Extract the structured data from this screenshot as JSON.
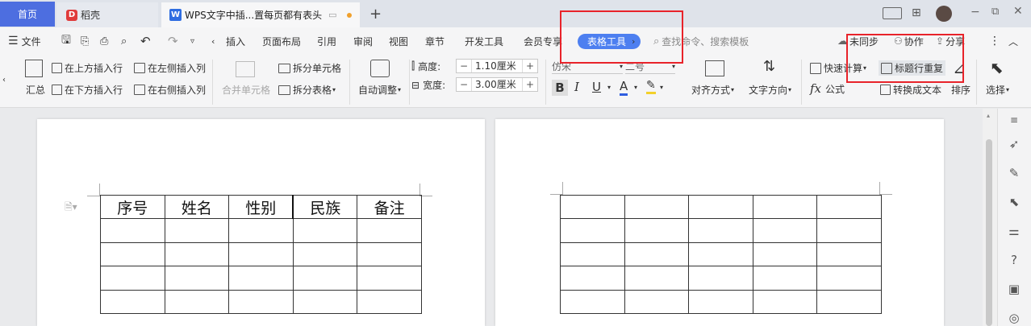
{
  "tabs": {
    "home": "首页",
    "daoke": "稻壳",
    "doc_title": "WPS文字中插...置每页都有表头"
  },
  "menu": {
    "file": "文件",
    "items": [
      "插入",
      "页面布局",
      "引用",
      "审阅",
      "视图",
      "章节",
      "开发工具",
      "会员专享"
    ],
    "table_tools": "表格工具",
    "search_placeholder": "查找命令、搜索模板",
    "unsynced": "未同步",
    "collab": "协作",
    "share": "分享"
  },
  "ribbon": {
    "summary": "汇总",
    "insert_above": "在上方插入行",
    "insert_left": "在左侧插入列",
    "insert_below": "在下方插入行",
    "insert_right": "在右侧插入列",
    "merge_cells": "合并单元格",
    "split_cell": "拆分单元格",
    "split_table": "拆分表格",
    "autofit": "自动调整",
    "height_label": "高度:",
    "height_value": "1.10厘米",
    "width_label": "宽度:",
    "width_value": "3.00厘米",
    "font_name": "仿宋",
    "font_size": "二号",
    "align": "对齐方式",
    "text_dir": "文字方向",
    "quick_calc": "快速计算",
    "formula": "公式",
    "title_repeat": "标题行重复",
    "convert_text": "转换成文本",
    "sort": "排序",
    "select": "选择",
    "step_minus": "−",
    "step_plus": "+"
  },
  "table": {
    "headers": [
      "序号",
      "姓名",
      "性别",
      "民族",
      "备注"
    ]
  },
  "colors": {
    "accent": "#4d7ff0",
    "highlight_box": "#e8232a"
  }
}
